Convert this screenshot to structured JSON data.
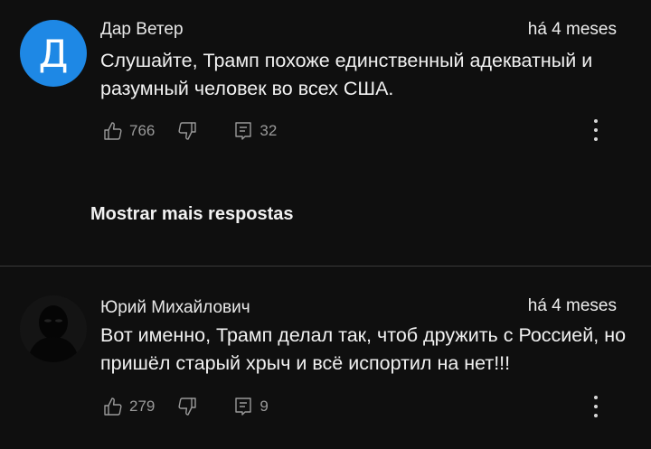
{
  "comments": [
    {
      "avatar_letter": "Д",
      "author": "Дар Ветер",
      "time": "há 4 meses",
      "text": "Слушайте, Трамп похоже единственный адекватный и разумный человек во всех США.",
      "likes": "766",
      "replies": "32"
    },
    {
      "author": "Юрий Михайлович",
      "time": "há 4 meses",
      "text": "Вот именно, Трамп делал так, чтоб дружить с Россией, но пришёл старый хрыч и всё испортил на нет!!!",
      "likes": "279",
      "replies": "9"
    }
  ],
  "show_more_replies": "Mostrar mais respostas",
  "colors": {
    "background": "#0f0f0f",
    "avatar_blue": "#1e88e5",
    "icon_gray": "#9a9a9a"
  },
  "icons": [
    "thumbs-up-icon",
    "thumbs-down-icon",
    "reply-icon",
    "more-vertical-icon"
  ]
}
